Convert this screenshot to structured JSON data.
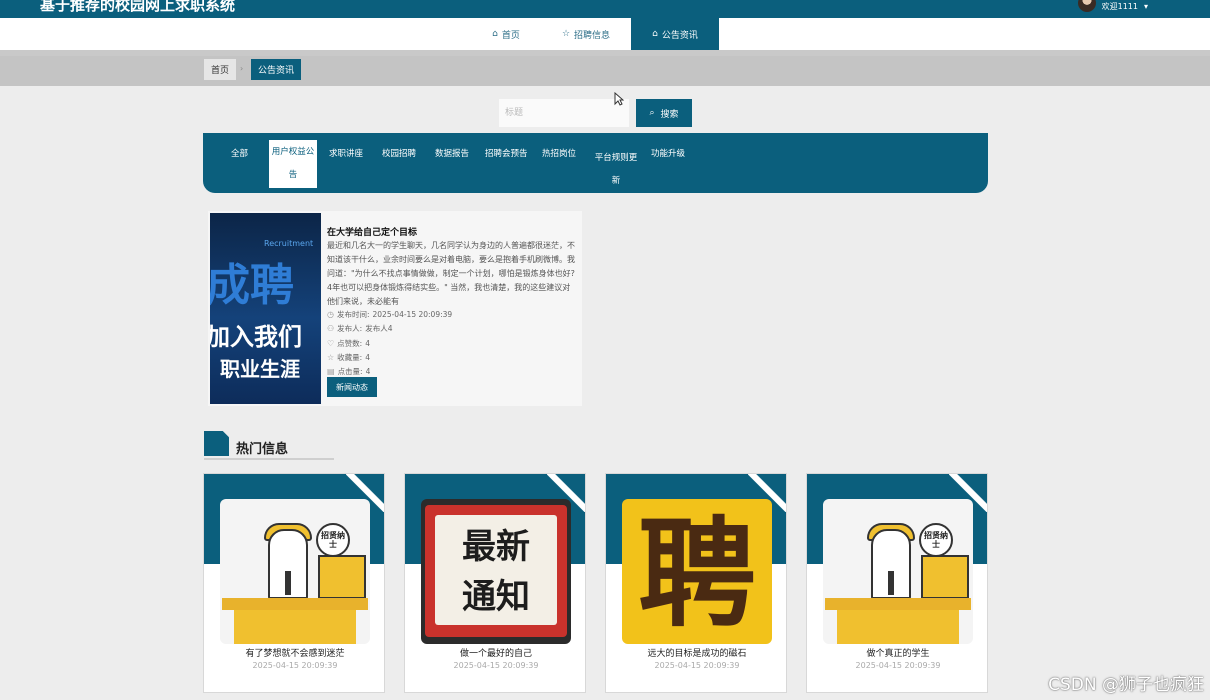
{
  "header": {
    "site_title": "基于推荐的校园网上求职系统",
    "user_greeting": "欢迎1111"
  },
  "nav": {
    "items": [
      {
        "label": "首页",
        "icon": "home-icon"
      },
      {
        "label": "招聘信息",
        "icon": "star-icon"
      },
      {
        "label": "公告资讯",
        "icon": "bag-icon",
        "active": true
      }
    ]
  },
  "breadcrumb": {
    "home": "首页",
    "current": "公告资讯"
  },
  "search": {
    "placeholder": "标题",
    "value": "",
    "button_label": "搜索"
  },
  "categories": [
    {
      "label": "全部"
    },
    {
      "label": "用户权益公告",
      "active": true
    },
    {
      "label": "求职讲座"
    },
    {
      "label": "校园招聘"
    },
    {
      "label": "数据报告"
    },
    {
      "label": "招聘会预告"
    },
    {
      "label": "热招岗位"
    },
    {
      "label": "平台规则更新"
    },
    {
      "label": "功能升级"
    }
  ],
  "news": {
    "image_text": [
      "Recruitment",
      "成聘",
      "加入我们",
      "职业生涯"
    ],
    "title": "在大学给自己定个目标",
    "body": "最近和几名大一的学生聊天，几名同学认为身边的人普遍都很迷茫，不知道该干什么，业余时间要么是对着电脑，要么是抱着手机刷微博。我问道：\"为什么不找点事情做做，制定一个计划，哪怕是锻炼身体也好?4年也可以把身体锻炼得结实些。\" 当然，我也清楚，我的这些建议对他们来说，未必能有",
    "publish_time_label": "发布时间:",
    "publish_time": "2025-04-15 20:09:39",
    "publisher_label": "发布人:",
    "publisher": "发布人4",
    "likes_label": "点赞数:",
    "likes": "4",
    "favorites_label": "收藏量:",
    "favorites": "4",
    "clicks_label": "点击量:",
    "clicks": "4",
    "tag": "新闻动态"
  },
  "hot": {
    "title": "热门信息",
    "items": [
      {
        "caption": "有了梦想就不会感到迷茫",
        "date": "2025-04-15 20:09:39",
        "bubble": "招贤纳士"
      },
      {
        "caption": "做一个最好的自己",
        "date": "2025-04-15 20:09:39",
        "pic_text": [
          "最新",
          "通知"
        ]
      },
      {
        "caption": "远大的目标是成功的磁石",
        "date": "2025-04-15 20:09:39",
        "pic_text": "聘"
      },
      {
        "caption": "做个真正的学生",
        "date": "2025-04-15 20:09:39",
        "bubble": "招贤纳士"
      }
    ]
  },
  "watermark": "CSDN @狮子也疯狂",
  "colors": {
    "primary": "#0b5f7d",
    "background": "#ededed",
    "breadcrumb_bar": "#c4c4c4"
  }
}
